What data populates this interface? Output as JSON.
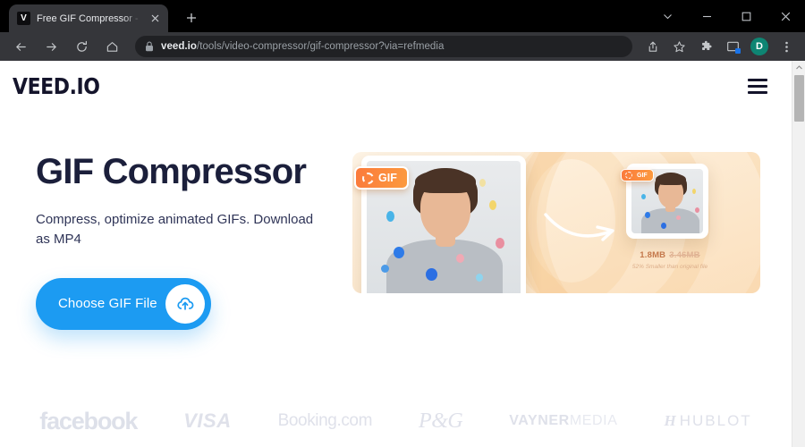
{
  "browser": {
    "tab": {
      "favicon_letter": "V",
      "title": "Free GIF Compressor - Compress",
      "close_icon": "close-icon"
    },
    "new_tab_label": "+",
    "window_controls": [
      "chevron-down-icon",
      "minimize-icon",
      "maximize-icon",
      "close-icon"
    ],
    "nav_icons": [
      "back-arrow-icon",
      "forward-arrow-icon",
      "reload-icon",
      "home-icon"
    ],
    "omnibox": {
      "lock_icon": "lock-icon",
      "url_domain": "veed.io",
      "url_path": "/tools/video-compressor/gif-compressor?via=refmedia"
    },
    "toolbar_icons": [
      "share-icon",
      "bookmark-star-icon",
      "extensions-puzzle-icon",
      "cast-icon"
    ],
    "profile_initial": "D"
  },
  "site": {
    "logo": "VEED.IO",
    "menu_icon": "hamburger-menu-icon"
  },
  "hero": {
    "title": "GIF Compressor",
    "subtitle": "Compress, optimize animated GIFs. Download as MP4",
    "cta_label": "Choose GIF File",
    "cta_icon": "cloud-upload-icon",
    "cta_color": "#1C9BF2"
  },
  "illustration": {
    "badge_large_label": "GIF",
    "badge_small_label": "GIF",
    "badge_color": "#FB7A3C",
    "arrow_icon": "curved-arrow-icon",
    "compressed_size": "1.8MB",
    "original_size": "3.46MB",
    "savings_note": "52% Smaller than original file"
  },
  "partners": [
    {
      "name": "facebook",
      "style": "p-fb"
    },
    {
      "name": "VISA",
      "style": "p-visa"
    },
    {
      "name": "Booking.com",
      "style": "p-booking"
    },
    {
      "name": "P&G",
      "style": "p-pg"
    },
    {
      "name": "VAYNERMEDIA",
      "style": "p-vayner",
      "bold_part": "VAYNER",
      "light_part": "MEDIA"
    },
    {
      "name": "HUBLOT",
      "style": "p-hublot",
      "mark": "H"
    }
  ]
}
